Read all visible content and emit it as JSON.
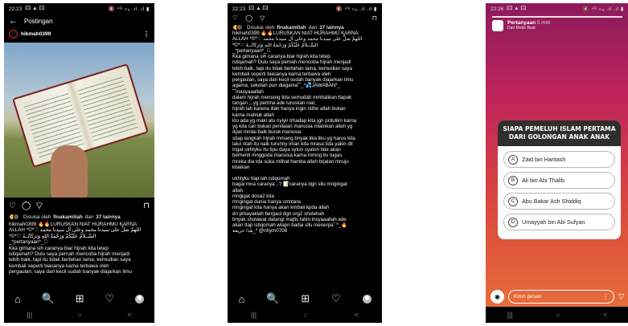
{
  "screens": [
    {
      "status": {
        "time": "22:23",
        "left_icons": "🖾 ▲ 🖾",
        "right_icons": "🔇 ⁴ᴳ ₗₜₑ .ıl .ıl ▮"
      },
      "topbar": {
        "back": "←",
        "title": "Postingan"
      },
      "user": {
        "name": "hikmah0399",
        "more": "⋮"
      },
      "actions": {
        "like": "♡",
        "comment": "◯",
        "share": "▽",
        "save": "⊓"
      },
      "likes": {
        "prefix": "Disukai oleh",
        "user": "finakamiliah",
        "mid": "dan",
        "others": "37 lainnya"
      },
      "caption_lines": [
        "hikmah0399 🔥🔥LURUSKAN NIAT HIJRAHMU KARNA",
        "ALLAH *©*♡ اللهمَّ صلِّ على سيدنا محمد وعلى آل سيدنا محمد",
        "*©*♡ السَّــلاَمُ عَلَيْكُمْ وَرَحْمَةُ اللهِ وَبَرَكَاتُــهُ",
        "_*pertanyaan*_🏼",
        "Kka gimana sih caranya biar hijrah kita tetep",
        "istiqamah? Dulu saya pernah mencoba hijrah menjadi",
        "lebih baik, tapi itu tidak bertahan lama, kemudian saya",
        "kembali seperti biasanya karna terbawa oleh",
        "pergaulan, saya dari kecil sudah banyak diajarkan ilmu"
      ],
      "ignav": [
        "⌂",
        "🔍",
        "⊞",
        "♡"
      ],
      "sysnav": [
        "|||",
        "○",
        "<"
      ]
    },
    {
      "status": {
        "time": "22:23",
        "left_icons": "🖾 ▲ 🖾",
        "right_icons": "🔇 ⁴ᴳ ₗₜₑ .ıl .ıl ▮"
      },
      "topicons": {
        "like": "♡",
        "comment": "◯",
        "share": "▽",
        "save": "⊓"
      },
      "likes": {
        "prefix": "Disukai oleh",
        "user": "finakamiliah",
        "mid": "dan",
        "others": "37 lainnya"
      },
      "caption_lines": [
        "hikmah0399 🔥🔥LURUSKAN NIAT HIJRAHMU KARNA",
        "ALLAH *©*♡ اللهمَّ صلِّ على سيدنا محمد وعلى آل سيدنا محمد",
        "*©*♡ السَّــلاَمُ عَلَيْكُمْ وَرَحْمَةُ اللهِ وَبَرَكَاتُــهُ",
        "_*pertanyaan*_🏼",
        "Kka gimana sih caranya biar hijrah kita tetep",
        "istiqamah? Dulu saya pernah mencoba hijrah menjadi",
        "lebih baik, tapi itu tidak bertahan lama, kemudian saya",
        "kembali seperti biasanya karna terbawa oleh",
        "pergaulan, saya dari kecil sudah banyak diajarkan ilmu",
        "agama, sekolah pun diagama˜˜_*💦JAWABAN*_",
        "˜˜masyaaallah",
        "dalam hijrah memang tida semudah mmbalikan tlapak",
        "tangan ,, yg pertma ade luruskan niat,",
        "hijrah lah karena illah hanya ingin ridho allah bukan",
        "karna mahluk allah",
        "klo ada yg maki atu nyiyir trhadap kita jgn prdulikn karna",
        "yg kita cari bukan penilaian manusia mlainkan allah yg",
        "dpat mnilai baik buruk manusia",
        "stiap langkah hijrah mmang bnyak lika liku yg harus kita",
        "lalui ntah itu naik turunny iman kita mrasa tida yakin dll",
        "ingat ukhtyku itu tipu daya syton syaton tida akan",
        "berhenti mnggoda manusia karna mmng itu tugas",
        "mreka dia tda suka milhat hamba allah brjalan mnuju",
        "kbaikan",
        "",
        "ukhtyku ttap lah istiqomah",
        "bagai mna caranya ..? 📝caranya dgn sllu mngingat",
        "allah",
        "mngigat dosa2 kita",
        "mngingat dunia hanya smntara",
        "mngingat kita hanya akan kmbali kpda allah",
        "dn prbayaklah bergaul dgn org2 sholehah",
        "bnyak sholawat datangi majlis talim insyaaallah ade",
        "akan ttap istiqomah wlapn badai sllu menerpa˜ *_🔥",
        "هذا خريفة_* @nhym0708"
      ],
      "ignav": [
        "⌂",
        "🔍",
        "⊞",
        "♡"
      ],
      "sysnav": [
        "|||",
        "○",
        "<"
      ]
    },
    {
      "status": {
        "time": "22:26",
        "left_icons": "🖾 ▲ 🖾",
        "right_icons": "🔇 ⁴ᴳ ₗₜₑ .ıl .ıl ▮"
      },
      "story": {
        "title": "Pertanyaan",
        "time": "5 mnt",
        "subtitle": "Dari Mode Buat"
      },
      "quiz": {
        "question": "SIAPA PEMELUH ISLAM PERTAMA DARI GOLONGAN ANAK ANAK",
        "options": [
          {
            "letter": "A",
            "text": "Zaid bin Haritash"
          },
          {
            "letter": "B",
            "text": "Ali bin Abi Thalib"
          },
          {
            "letter": "C",
            "text": "Abu Bakar Ash Shiddiq"
          },
          {
            "letter": "D",
            "text": "Umayyah bin Abi Sufyan"
          }
        ]
      },
      "message": {
        "camera": "◉",
        "placeholder": "Kirim pesan",
        "dots": "⋮",
        "send": "▽"
      },
      "sysnav": [
        "|||",
        "○",
        "<"
      ]
    }
  ]
}
